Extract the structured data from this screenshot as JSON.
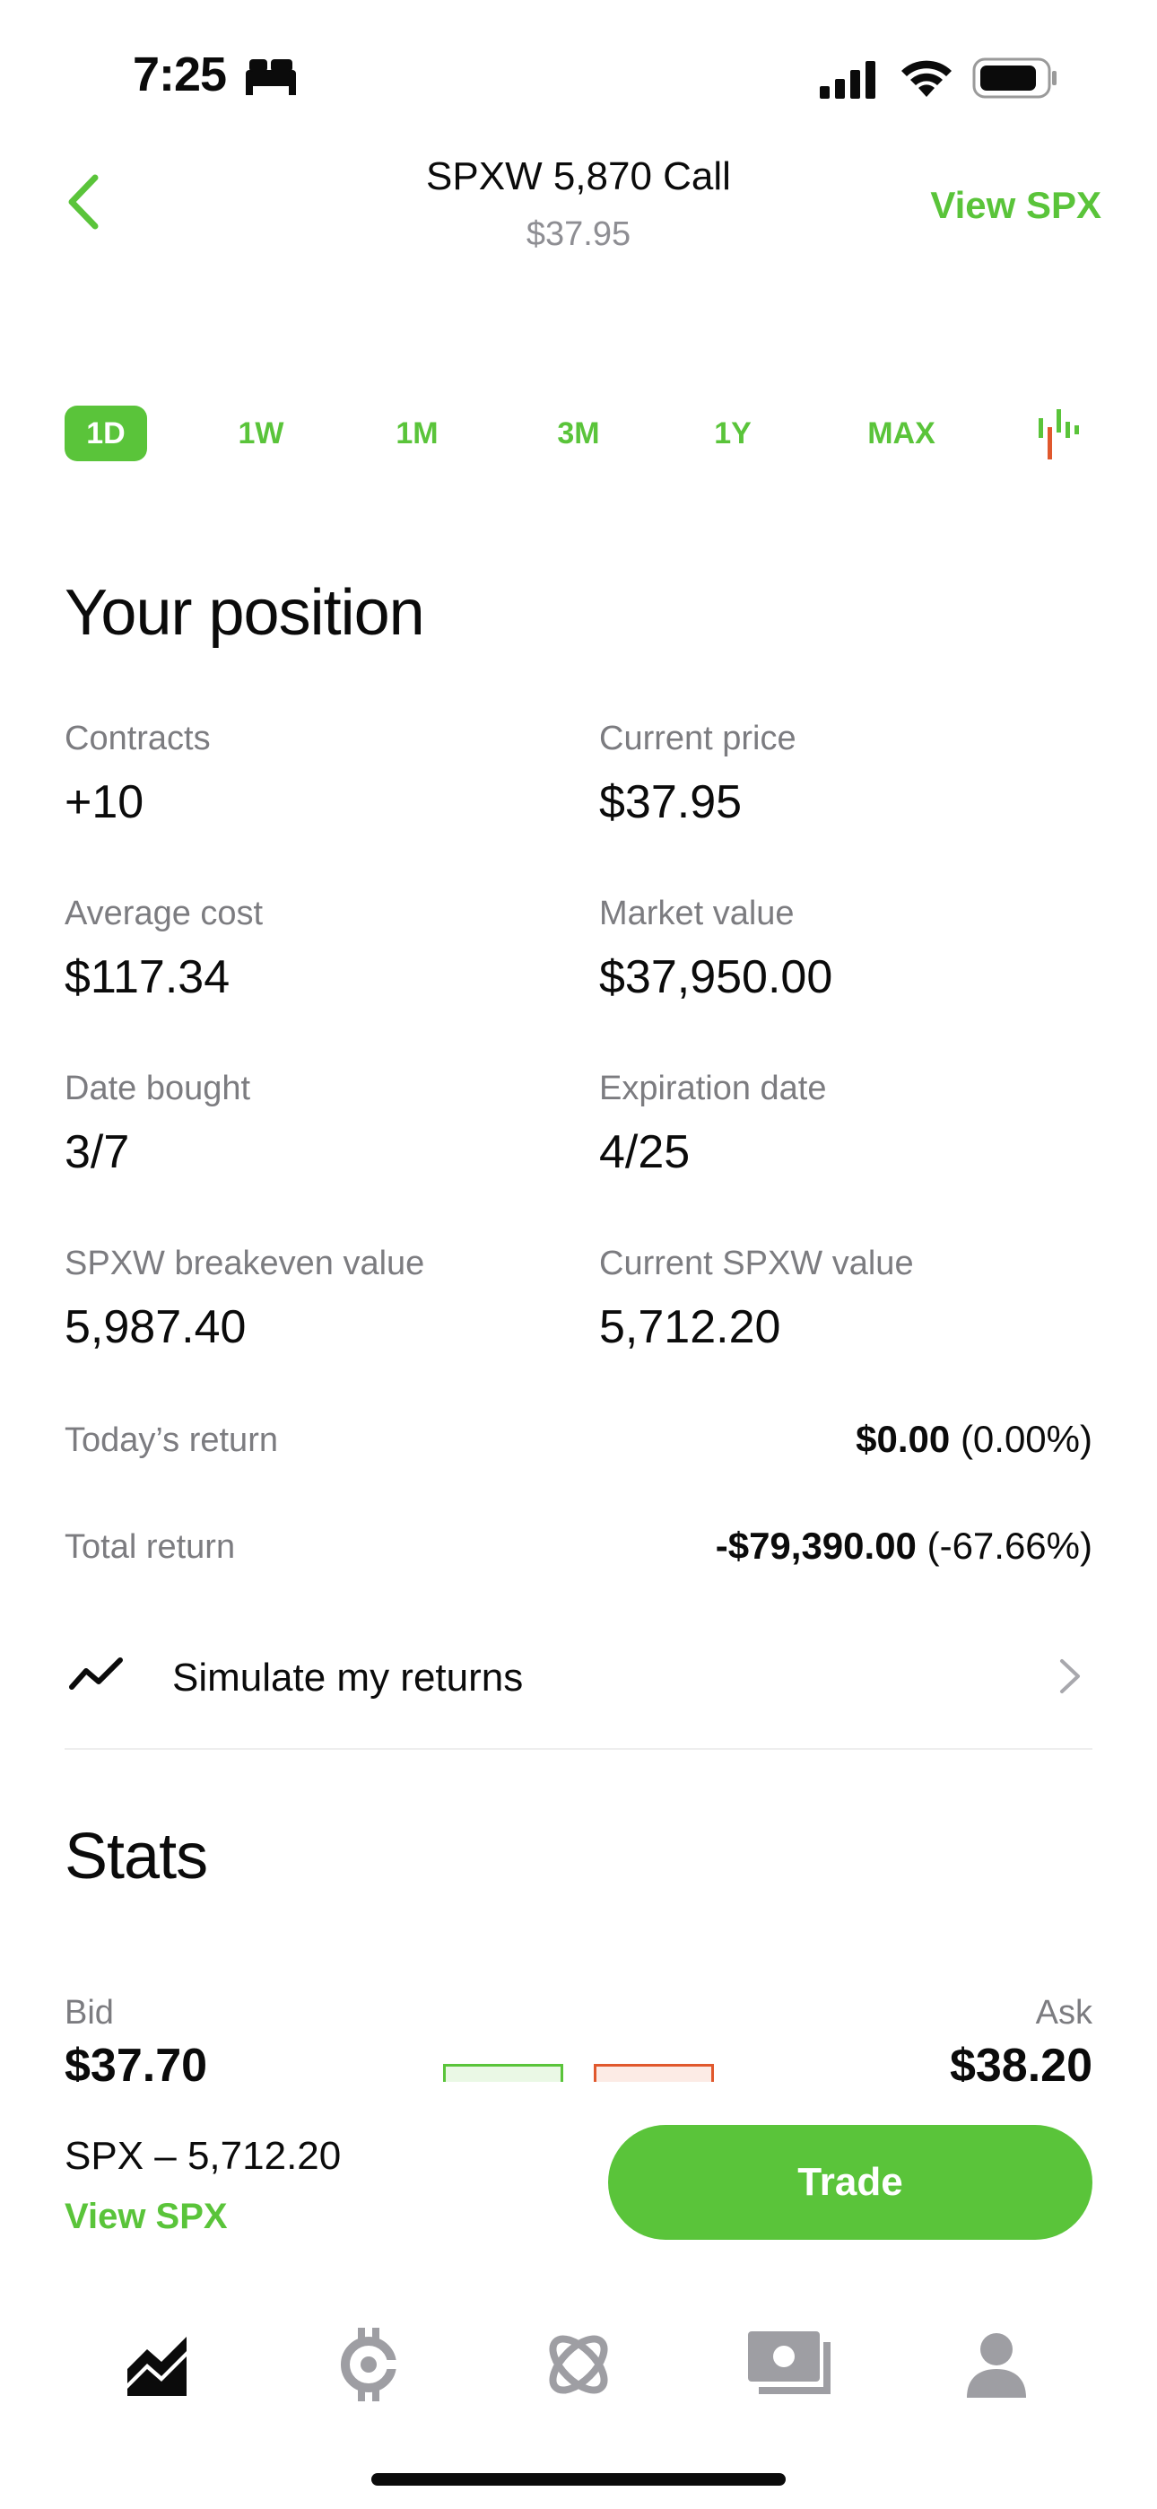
{
  "status_bar": {
    "time": "7:25"
  },
  "header": {
    "title": "SPXW 5,870 Call",
    "price": "$37.95",
    "view_link": "View SPX"
  },
  "ranges": [
    "1D",
    "1W",
    "1M",
    "3M",
    "1Y",
    "MAX"
  ],
  "position": {
    "title": "Your position",
    "contracts_label": "Contracts",
    "contracts_value": "+10",
    "current_price_label": "Current price",
    "current_price_value": "$37.95",
    "avg_cost_label": "Average cost",
    "avg_cost_value": "$117.34",
    "market_value_label": "Market value",
    "market_value_value": "$37,950.00",
    "date_bought_label": "Date bought",
    "date_bought_value": "3/7",
    "expiration_label": "Expiration date",
    "expiration_value": "4/25",
    "breakeven_label": "SPXW breakeven value",
    "breakeven_value": "5,987.40",
    "current_spxw_label": "Current SPXW value",
    "current_spxw_value": "5,712.20",
    "todays_return_label": "Today’s return",
    "todays_return_amount": "$0.00",
    "todays_return_pct": "(0.00%)",
    "total_return_label": "Total return",
    "total_return_amount": "-$79,390.00",
    "total_return_pct": "(-67.66%)",
    "simulate_label": "Simulate my returns"
  },
  "stats": {
    "title": "Stats",
    "bid_label": "Bid",
    "bid_value": "$37.70",
    "ask_label": "Ask",
    "ask_value": "$38.20"
  },
  "bottom": {
    "underlying": "SPX – 5,712.20",
    "view_link": "View SPX",
    "trade_label": "Trade"
  },
  "colors": {
    "accent": "#5ac43a",
    "negative": "#e0582d",
    "muted": "#7c7c80"
  }
}
